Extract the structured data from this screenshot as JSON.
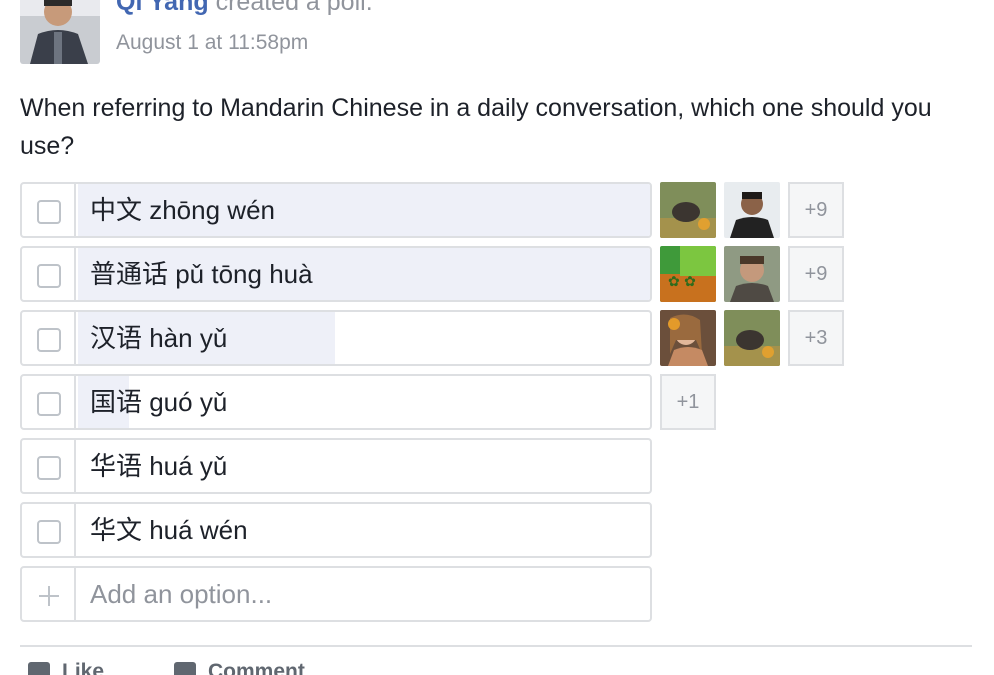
{
  "post": {
    "author": "Qi Yang",
    "action": "created a poll.",
    "timestamp": "August 1 at 11:58pm"
  },
  "poll": {
    "question": "When referring to Mandarin Chinese in a daily conversation, which one should you use?",
    "options": [
      {
        "label": "中文 zhōng wén",
        "share": 1.0,
        "more_voters": "+9"
      },
      {
        "label": "普通话 pǔ tōng huà",
        "share": 1.0,
        "more_voters": "+9"
      },
      {
        "label": "汉语 hàn yǔ",
        "share": 0.45,
        "more_voters": "+3"
      },
      {
        "label": "国语 guó yǔ",
        "share": 0.09,
        "more_voters": "+1"
      },
      {
        "label": "华语 huá yǔ",
        "share": 0.0,
        "more_voters": ""
      },
      {
        "label": "华文 huá wén",
        "share": 0.0,
        "more_voters": ""
      }
    ],
    "add_option_placeholder": "Add an option..."
  },
  "footer": {
    "like_label": "Like",
    "comment_label": "Comment"
  },
  "colors": {
    "link": "#4267b2",
    "muted": "#90949c",
    "border": "#dddfe2",
    "result_fill": "#eef0f8"
  }
}
